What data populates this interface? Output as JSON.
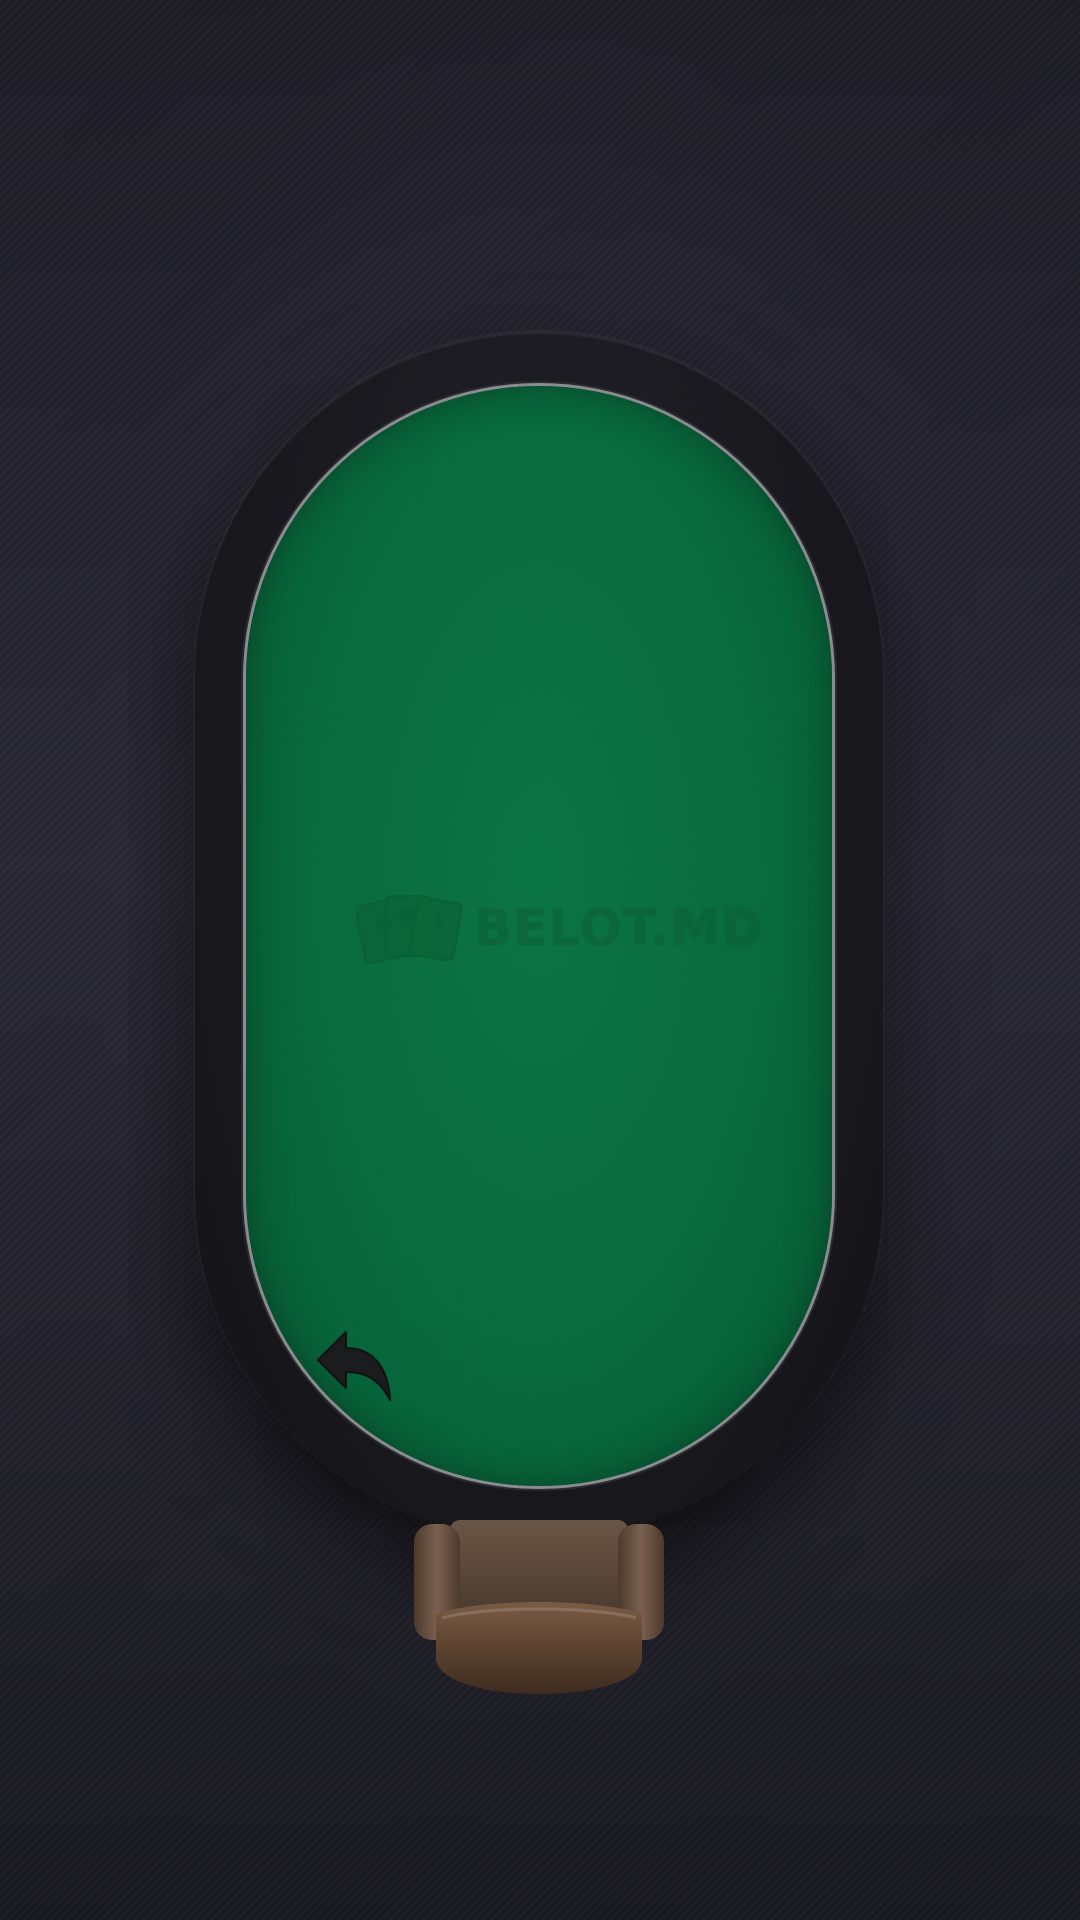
{
  "table": {
    "felt_color": "#076a3d",
    "rail_color": "#18181d",
    "trim_color": "#8a8c90"
  },
  "logo": {
    "text": "BELOT.MD",
    "icon": "playing-cards-icon"
  },
  "back_button": {
    "icon": "back-arrow-icon"
  },
  "seat": {
    "icon": "chair-icon",
    "color": "#5a4536"
  }
}
